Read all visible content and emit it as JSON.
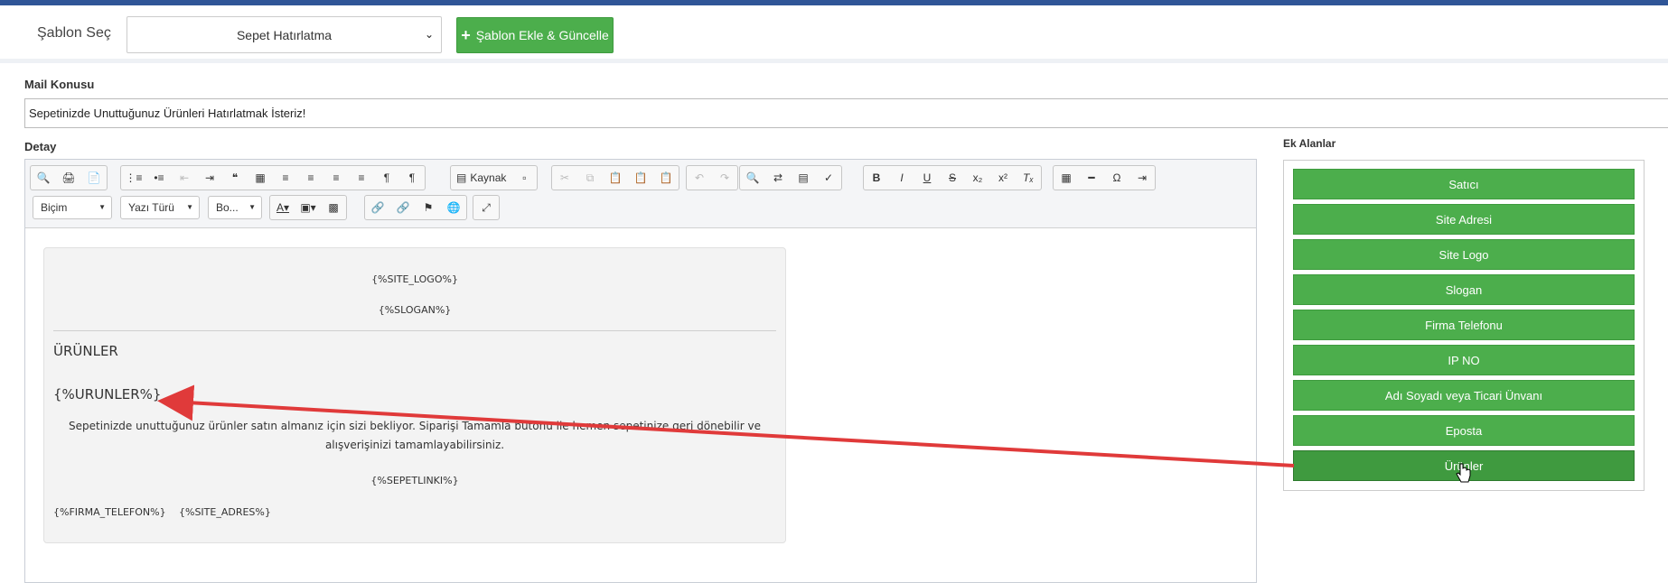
{
  "template": {
    "label": "Şablon Seç",
    "selected": "Sepet Hatırlatma",
    "add_button": "Şablon Ekle & Güncelle"
  },
  "subject": {
    "label": "Mail Konusu",
    "value": "Sepetinizde Unuttuğunuz Ürünleri Hatırlatmak İsteriz!"
  },
  "detail": {
    "label": "Detay",
    "toolbar": {
      "source_label": "Kaynak",
      "format_combo": "Biçim",
      "font_combo": "Yazı Türü",
      "size_combo": "Bo..."
    },
    "content": {
      "site_logo": "{%SITE_LOGO%}",
      "slogan": "{%SLOGAN%}",
      "products_heading": "ÜRÜNLER",
      "products_placeholder": "{%URUNLER%}",
      "description": "Sepetinizde unuttuğunuz ürünler satın almanız için sizi bekliyor. Siparişi Tamamla butonu ile hemen sepetinize geri dönebilir ve alışverişinizi tamamlayabilirsiniz.",
      "cart_link": "{%SEPETLINKI%}",
      "company_phone": "{%FIRMA_TELEFON%}",
      "site_address": "{%SITE_ADRES%}"
    }
  },
  "extra_fields": {
    "label": "Ek Alanlar",
    "items": [
      {
        "label": "Satıcı"
      },
      {
        "label": "Site Adresi"
      },
      {
        "label": "Site Logo"
      },
      {
        "label": "Slogan"
      },
      {
        "label": "Firma Telefonu"
      },
      {
        "label": "IP NO"
      },
      {
        "label": "Adı Soyadı veya Ticari Ünvanı"
      },
      {
        "label": "Eposta"
      },
      {
        "label": "Ürünler"
      }
    ]
  },
  "colors": {
    "primary_green": "#4cae4c",
    "annotation_arrow": "#e03a3a",
    "header_accent": "#2f5597"
  }
}
